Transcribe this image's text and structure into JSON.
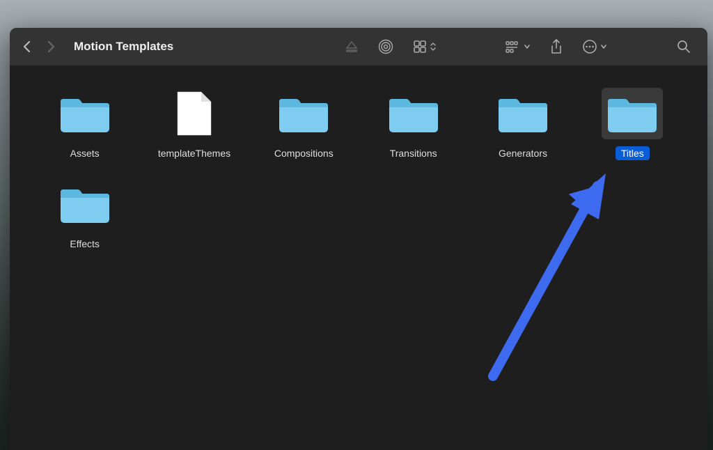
{
  "window": {
    "title": "Motion Templates"
  },
  "items": [
    {
      "name": "Assets",
      "type": "folder",
      "selected": false
    },
    {
      "name": "templateThemes",
      "type": "file",
      "selected": false
    },
    {
      "name": "Compositions",
      "type": "folder",
      "selected": false
    },
    {
      "name": "Transitions",
      "type": "folder",
      "selected": false
    },
    {
      "name": "Generators",
      "type": "folder",
      "selected": false
    },
    {
      "name": "Titles",
      "type": "folder",
      "selected": true
    },
    {
      "name": "Effects",
      "type": "folder",
      "selected": false
    }
  ],
  "colors": {
    "folder": "#7ecdf1",
    "folderDark": "#5db8e0",
    "selection": "#0a5dd6",
    "arrow": "#3e6af0"
  }
}
